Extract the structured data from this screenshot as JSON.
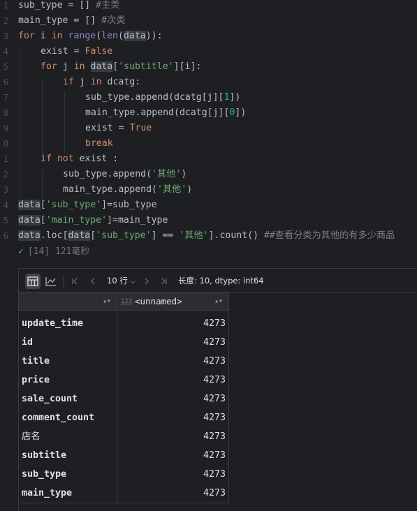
{
  "gutter": {
    "line_numbers": [
      "1",
      "2",
      "3",
      "4",
      "5",
      "6",
      "7",
      "8",
      "9",
      "0",
      "1",
      "2",
      "3",
      "4",
      "5",
      "6"
    ]
  },
  "code": {
    "l1_var": "sub_type",
    "l1_op": " = [] ",
    "l1_comment": "#主类",
    "l2_var": "main_type",
    "l2_op": " = [] ",
    "l2_comment": "#次类",
    "l3": {
      "kw_for": "for",
      "v": " i ",
      "kw_in": "in",
      "sp": " ",
      "range": "range",
      "p1": "(",
      "len": "len",
      "p2": "(",
      "data": "data",
      "p3": ")):"
    },
    "l4": {
      "v": "exist = ",
      "kw": "False"
    },
    "l5": {
      "kw_for": "for",
      "v": " j ",
      "kw_in": "in",
      "sp": " ",
      "data": "data",
      "b1": "[",
      "str": "'subtitle'",
      "rest": "][i]:"
    },
    "l6": {
      "kw_if": "if",
      "v": " j ",
      "kw_in": "in",
      "rest": " dcatg:"
    },
    "l7": {
      "a": "sub_type.append(dcatg[j][",
      "num": "1",
      "b": "])"
    },
    "l8": {
      "a": "main_type.append(dcatg[j][",
      "num": "0",
      "b": "])"
    },
    "l9": {
      "v": "exist = ",
      "kw": "True"
    },
    "l10": {
      "kw": "break"
    },
    "l11": {
      "kw_if": "if",
      "sp": " ",
      "kw_not": "not",
      "rest": " exist :"
    },
    "l12": {
      "a": "sub_type.append(",
      "str": "'其他'",
      "b": ")"
    },
    "l13": {
      "a": "main_type.append(",
      "str": "'其他'",
      "b": ")"
    },
    "l14": {
      "data": "data",
      "b1": "[",
      "str": "'sub_type'",
      "rest": "]=sub_type"
    },
    "l15": {
      "data": "data",
      "b1": "[",
      "str": "'main_type'",
      "rest": "]=main_type"
    },
    "l16": {
      "data": "data",
      "loc": ".loc[",
      "data2": "data",
      "b1": "[",
      "str": "'sub_type'",
      "mid": "] == ",
      "str2": "'其他'",
      "rest": "].count() ",
      "comment": "##查看分类为其他的有多少商品"
    }
  },
  "status": {
    "check": "✓",
    "text": "[14] 121毫秒"
  },
  "toolbar": {
    "rows_label": "10 行",
    "info": "长度: 10, dtype: int64"
  },
  "table": {
    "col1_header": "",
    "col2_icon": "123",
    "col2_header": "<unnamed>",
    "rows": [
      {
        "name": "update_time",
        "value": "4273"
      },
      {
        "name": "id",
        "value": "4273"
      },
      {
        "name": "title",
        "value": "4273"
      },
      {
        "name": "price",
        "value": "4273"
      },
      {
        "name": "sale_count",
        "value": "4273"
      },
      {
        "name": "comment_count",
        "value": "4273"
      },
      {
        "name": "店名",
        "value": "4273"
      },
      {
        "name": "subtitle",
        "value": "4273"
      },
      {
        "name": "sub_type",
        "value": "4273"
      },
      {
        "name": "main_type",
        "value": "4273"
      }
    ]
  },
  "colors": {
    "background": "#1e1f22",
    "keyword": "#cf8e6d",
    "string": "#6aab73",
    "number": "#2aacb8",
    "builtin": "#8888c6",
    "comment": "#7a7e85",
    "success": "#5fb865"
  }
}
